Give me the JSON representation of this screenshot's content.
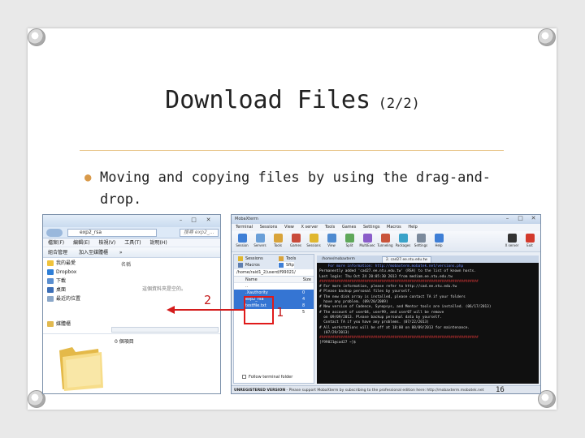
{
  "slide": {
    "title": "Download Files",
    "title_suffix": "(2/2)",
    "bullet": "Moving and copying files by using the drag-and-drop.",
    "page_number": "16",
    "annotation_1": "1",
    "annotation_2": "2",
    "accent_color": "#d99a4a",
    "arrow_color": "#d41c1c"
  },
  "explorer": {
    "path": "exp2_rsa",
    "search_placeholder": "搜尋 exp2_...",
    "menu": [
      "檔案(F)",
      "編輯(E)",
      "檢視(V)",
      "工具(T)",
      "說明(H)"
    ],
    "commands": [
      "組合管理",
      "加入至媒體櫃",
      "»"
    ],
    "nav_items": [
      {
        "label": "我的最愛",
        "icon": "star-icon"
      },
      {
        "label": "Dropbox",
        "icon": "dropbox-icon"
      },
      {
        "label": "下載",
        "icon": "download-icon"
      },
      {
        "label": "桌面",
        "icon": "desktop-icon"
      },
      {
        "label": "最近的位置",
        "icon": "recent-places-icon"
      },
      {
        "label": "媒體櫃",
        "icon": "library-icon"
      }
    ],
    "column_header": "名稱",
    "empty_text": "這個資料夾是空的。",
    "item_count": "0 個項目"
  },
  "moba": {
    "title": "MobaXterm",
    "menu": [
      "Terminal",
      "Sessions",
      "View",
      "X server",
      "Tools",
      "Games",
      "Settings",
      "Macros",
      "Help"
    ],
    "toolbar": [
      "Session",
      "Servers",
      "Tools",
      "Games",
      "Sessions",
      "View",
      "Split",
      "MultiExec",
      "Tunneling",
      "Packages",
      "Settings",
      "Help",
      "X server",
      "Exit"
    ],
    "side_tabs": [
      "Sessions",
      "Tools",
      "Macros",
      "Sftp"
    ],
    "remote_path": "/home/raid1_2/userd/f99021/",
    "name_header": "Name",
    "size_header": "Size",
    "files": [
      {
        "name": "..",
        "size": ""
      },
      {
        "name": ".Xauthority",
        "size": "0"
      },
      {
        "name": "exp2_rsa",
        "size": "4"
      },
      {
        "name": "testfile.txt",
        "size": "8"
      },
      {
        "name": "",
        "size": "5"
      }
    ],
    "follow_label": "Follow terminal folder",
    "term_tabs": [
      "/home/mobaxterm",
      "2. cad27.ee.ntu.edu.tw"
    ],
    "terminal_lines": [
      "    For more information: http://mobaxterm.mobatek.net/versions.php",
      "",
      "Permanently added 'cad27.ee.ntu.edu.tw' (RSA) to the list of known hosts.",
      "Last login: Thu Oct 24 20:05:30 2013 from mediam.ee.ntu.edu.tw",
      "##########################################################################",
      "",
      "# For more information, please refer to http://cad.ee.ntu.edu.tw",
      "",
      "# Please backup personal files by yourself.",
      "",
      "# The new disk array is installed, please contact TA if your folders",
      "  have any problem. (09/20/2009)",
      "",
      "# New version of Cadence, Synopsys, and Mentor tools are installed. (06/17/2013)",
      "",
      "# The account of user04, user99, and user07 will be remove",
      "  on 09/09/2013. Please backup personal data by yourself.",
      "  Contact TA if you have any problems. (07/22/2013)",
      "",
      "# All workstations will be off at 18:00 on 08/09/2013 for maintenance.",
      "  (07/29/2013)",
      "##########################################################################",
      "[f99021@cad27 ~]$ "
    ],
    "status_prefix": "UNREGISTERED VERSION",
    "status_text": " - Please support MobaXterm by subscribing to the professional edition here: http://mobaxterm.mobatek.net"
  }
}
